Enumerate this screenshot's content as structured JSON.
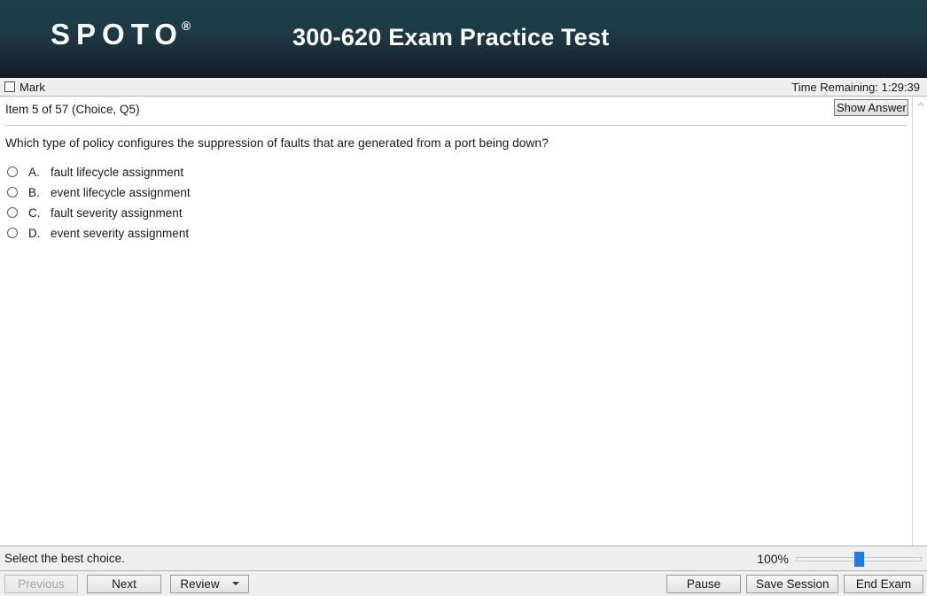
{
  "header": {
    "logo_text": "SPOTO",
    "logo_registered": "®",
    "title": "300-620 Exam Practice Test"
  },
  "markbar": {
    "mark_label": "Mark",
    "timer_text": "Time Remaining: 1:29:39"
  },
  "question_panel": {
    "item_label": "Item 5 of 57  (Choice, Q5)",
    "show_answer_label": "Show Answer",
    "question_text": "Which type of policy configures the suppression of faults that are generated from a port being down?",
    "options": [
      {
        "letter": "A.",
        "text": "fault lifecycle assignment",
        "selected": false
      },
      {
        "letter": "B.",
        "text": "event lifecycle assignment",
        "selected": false
      },
      {
        "letter": "C.",
        "text": "fault severity assignment",
        "selected": false
      },
      {
        "letter": "D.",
        "text": "event severity assignment",
        "selected": false
      }
    ]
  },
  "statusbar": {
    "status_text": "Select the best choice.",
    "zoom_percent": "100%",
    "zoom_value": 100
  },
  "buttonbar": {
    "previous_label": "Previous",
    "next_label": "Next",
    "review_label": "Review",
    "pause_label": "Pause",
    "save_session_label": "Save Session",
    "end_exam_label": "End Exam"
  },
  "colors": {
    "header_top": "#1d3d48",
    "header_bottom": "#151b26",
    "slider_thumb": "#1a7ee8",
    "chrome_grey": "#efefef"
  }
}
